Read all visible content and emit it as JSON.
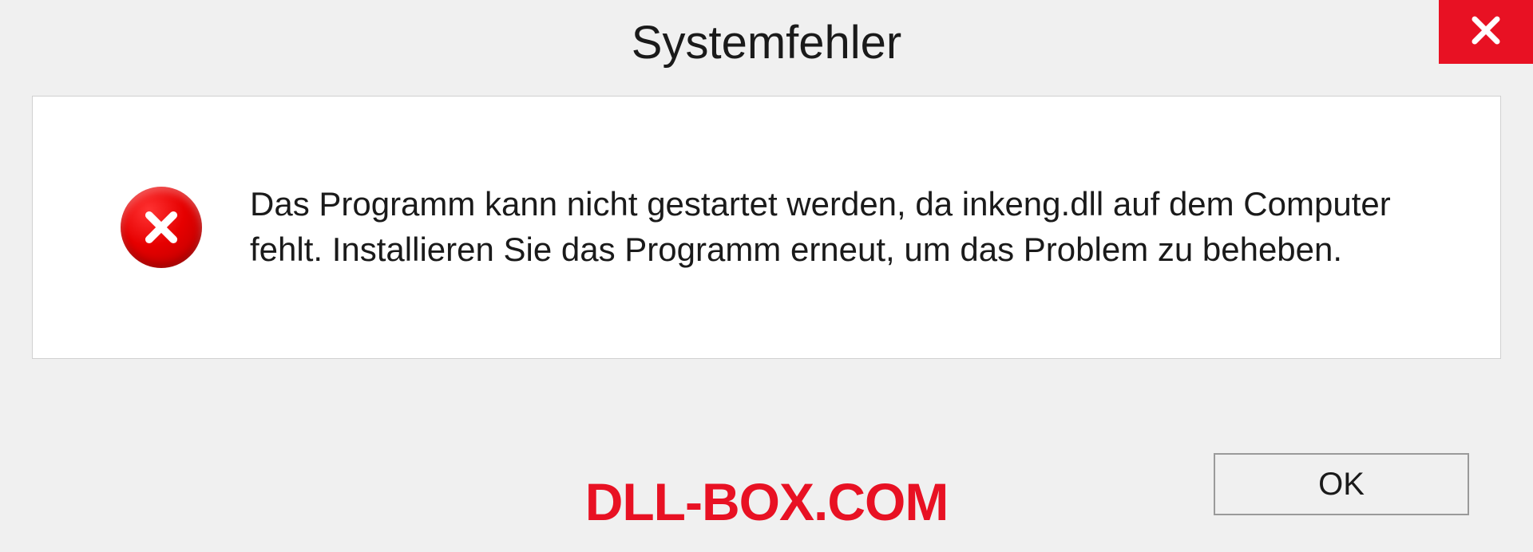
{
  "dialog": {
    "title": "Systemfehler",
    "message": "Das Programm kann nicht gestartet werden, da inkeng.dll auf dem Computer fehlt. Installieren Sie das Programm erneut, um das Problem zu beheben.",
    "ok_label": "OK"
  },
  "watermark": "DLL-BOX.COM",
  "colors": {
    "error_red": "#e81123",
    "close_red": "#e81123"
  }
}
